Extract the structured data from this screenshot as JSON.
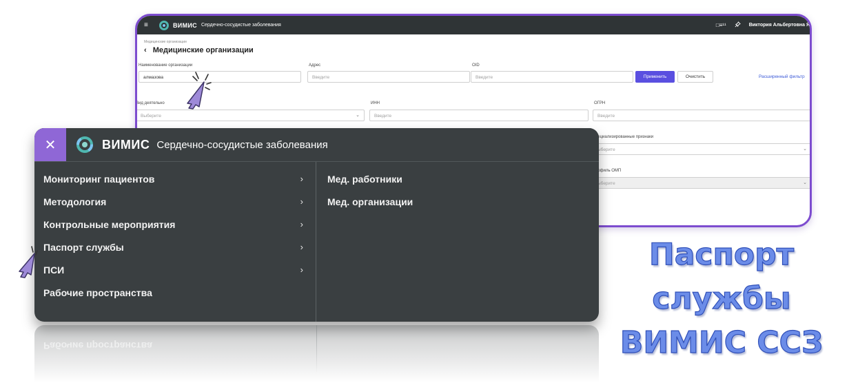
{
  "bg_window": {
    "topbar": {
      "brand": "ВИМИС",
      "subtitle": "Сердечно-сосудистые заболевания",
      "notif": "□≡¹¹",
      "user": "Виктория Альбертовна Я"
    },
    "breadcrumb": "Медицинские организации",
    "title": "Медицинские организации",
    "back_symbol": "‹",
    "filters": {
      "org_name_label": "Наименование организации",
      "org_name_value": "алмазова",
      "address_label": "Адрес",
      "address_placeholder": "Введите",
      "oid_label": "OID",
      "oid_placeholder": "Введите",
      "apply_label": "Применить",
      "clear_label": "Очистить",
      "advanced_filter": "Расширенный фильтр",
      "activity_label": "Вид деятельно",
      "activity_placeholder": "Выберите",
      "inn_label": "ИНН",
      "inn_placeholder": "Введите",
      "ogrn_label": "ОГРН",
      "ogrn_placeholder": "Введите",
      "special_label": "пециализированные признаки",
      "special_placeholder": "ыберите",
      "omp_label": "рофиль ОМП",
      "omp_placeholder": "ыберите"
    }
  },
  "menu": {
    "close_symbol": "✕",
    "brand": "ВИМИС",
    "subtitle": "Сердечно-сосудистые заболевания",
    "arrow": "›",
    "left_items": [
      {
        "label": "Мониторинг пациентов",
        "has_arrow": true
      },
      {
        "label": "Методология",
        "has_arrow": true
      },
      {
        "label": "Контрольные мероприятия",
        "has_arrow": true
      },
      {
        "label": "Паспорт службы",
        "has_arrow": true
      },
      {
        "label": "ПСИ",
        "has_arrow": true
      },
      {
        "label": "Рабочие пространства",
        "has_arrow": false
      }
    ],
    "right_items": [
      {
        "label": "Мед. работники"
      },
      {
        "label": "Мед. организации"
      }
    ]
  },
  "reflection_text": "Рабочие пространства",
  "caption": {
    "line1": "Паспорт",
    "line2": "службы",
    "line3": "ВИМИС ССЗ"
  },
  "colors": {
    "accent_purple": "#8f67d6",
    "menu_bg": "#3a3f41",
    "apply_button": "#5a4fe0",
    "caption": "#6b8ce8"
  }
}
